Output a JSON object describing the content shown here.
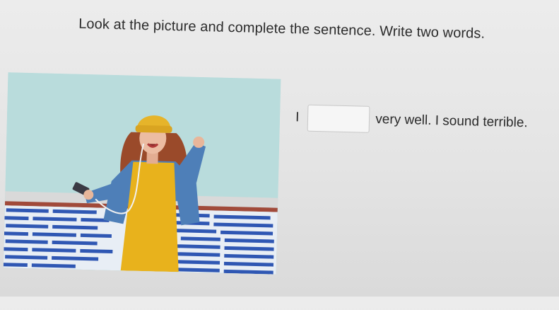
{
  "question": {
    "instruction": "Look at the picture and complete the sentence. Write two words."
  },
  "image": {
    "icon": "photo-woman-singing-with-headphones"
  },
  "sentence": {
    "prefix": "I",
    "answer_value": "",
    "suffix": "very well. I sound terrible."
  },
  "colors": {
    "wall": "#b9dcdc",
    "brick": "#2f57b3",
    "dress": "#e8b21c",
    "jacket": "#4e7fb8",
    "beanie": "#e6b42a"
  }
}
